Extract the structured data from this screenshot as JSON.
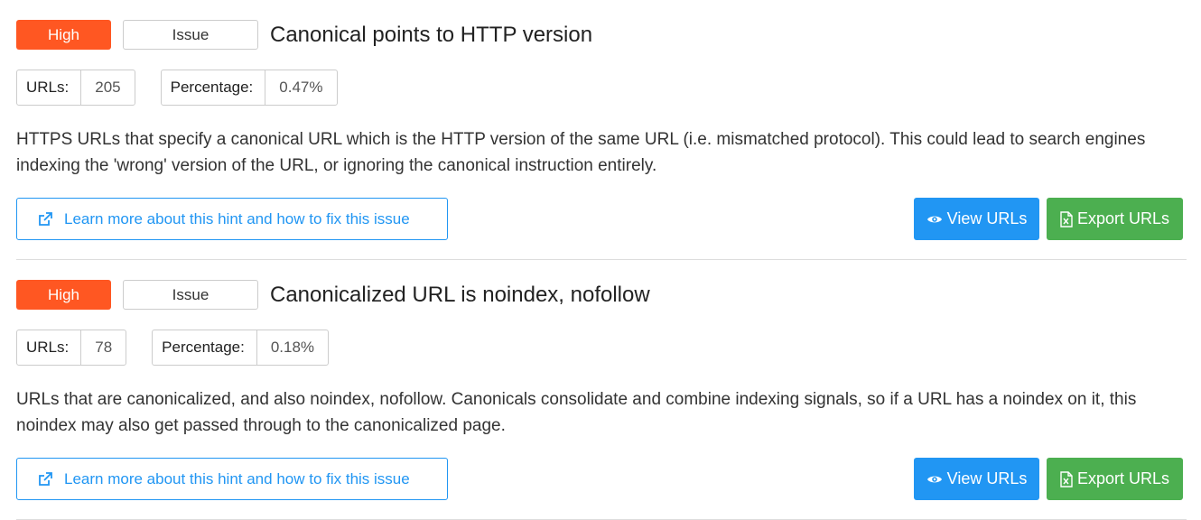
{
  "hints": [
    {
      "priority": "High",
      "type": "Issue",
      "title": "Canonical points to HTTP version",
      "urls_label": "URLs:",
      "urls_value": "205",
      "percentage_label": "Percentage:",
      "percentage_value": "0.47%",
      "description": "HTTPS URLs that specify a canonical URL which is the HTTP version of the same URL (i.e. mismatched protocol). This could lead to search engines indexing the 'wrong' version of the URL, or ignoring the canonical instruction entirely.",
      "learn_more": "Learn more about this hint and how to fix this issue",
      "view_urls": "View URLs",
      "export_urls": "Export URLs"
    },
    {
      "priority": "High",
      "type": "Issue",
      "title": "Canonicalized URL is noindex, nofollow",
      "urls_label": "URLs:",
      "urls_value": "78",
      "percentage_label": "Percentage:",
      "percentage_value": "0.18%",
      "description": "URLs that are canonicalized, and also noindex, nofollow. Canonicals consolidate and combine indexing signals, so if a URL has a noindex on it, this noindex may also get passed through to the canonicalized page.",
      "learn_more": "Learn more about this hint and how to fix this issue",
      "view_urls": "View URLs",
      "export_urls": "Export URLs"
    }
  ],
  "icons": {
    "learn_more": "external-link-icon",
    "view_urls": "eye-icon",
    "export_urls": "excel-file-icon"
  },
  "colors": {
    "priority_high": "#ff5722",
    "link": "#2196f3",
    "view_button": "#2196f3",
    "export_button": "#4caf50"
  }
}
